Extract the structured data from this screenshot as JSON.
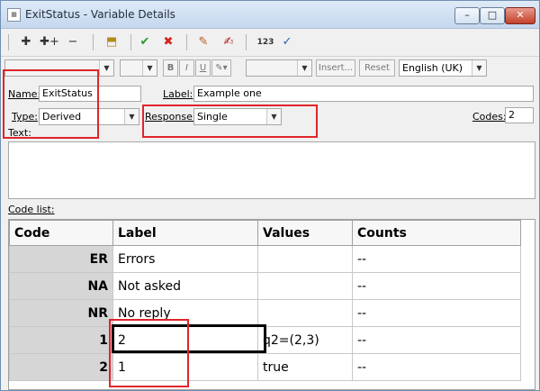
{
  "window": {
    "title": "ExitStatus - Variable Details",
    "controls": [
      "minimize",
      "maximize",
      "close"
    ]
  },
  "toolbar": {
    "icons": [
      "add-icon",
      "add-multiple-icon",
      "remove-icon",
      "folder-up-icon",
      "check-icon",
      "cancel-icon",
      "edit-icon",
      "sign-icon",
      "numeric-icon",
      "spellcheck-icon"
    ],
    "numeric_label": "123"
  },
  "format_bar": {
    "bold": "B",
    "italic": "I",
    "underline": "U",
    "insert_label": "Insert...",
    "reset_label": "Reset",
    "language": "English (UK)"
  },
  "form": {
    "name_label": "Name:",
    "name_value": "ExitStatus",
    "label_label": "Label:",
    "label_value": "Example one",
    "type_label": "Type:",
    "type_value": "Derived",
    "response_label": "Response:",
    "response_value": "Single",
    "codes_label": "Codes:",
    "codes_value": "2",
    "text_label": "Text:",
    "codelist_label": "Code list:"
  },
  "code_list": {
    "columns": [
      "Code",
      "Label",
      "Values",
      "Counts"
    ],
    "rows": [
      {
        "code": "ER",
        "label": "Errors",
        "values": "",
        "counts": "--"
      },
      {
        "code": "NA",
        "label": "Not asked",
        "values": "",
        "counts": "--"
      },
      {
        "code": "NR",
        "label": "No reply",
        "values": "",
        "counts": "--"
      },
      {
        "code": "1",
        "label": "2",
        "values": "q2=(2,3)",
        "counts": "--"
      },
      {
        "code": "2",
        "label": "1",
        "values": "true",
        "counts": "--"
      }
    ]
  },
  "colors": {
    "highlight": "#e0252a",
    "code_column": "#d6d6d6",
    "check": "#2a9a2a",
    "cancel": "#d0241e"
  }
}
